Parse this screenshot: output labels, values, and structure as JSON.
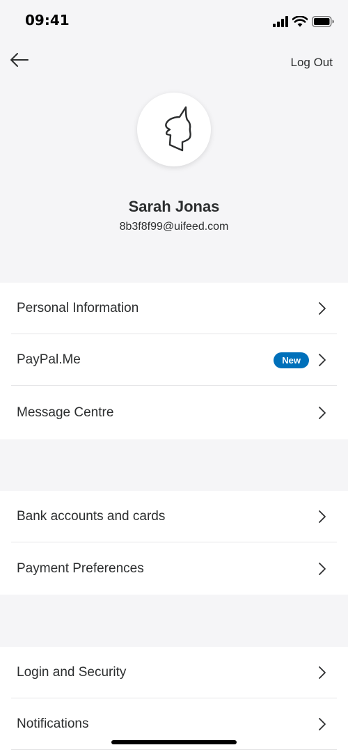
{
  "status_bar": {
    "time": "09:41"
  },
  "header": {
    "logout_label": "Log Out"
  },
  "profile": {
    "name": "Sarah Jonas",
    "email": "8b3f8f99@uifeed.com"
  },
  "menu_groups": [
    {
      "items": [
        {
          "label": "Personal Information"
        },
        {
          "label": "PayPal.Me",
          "badge": "New"
        },
        {
          "label": "Message Centre"
        }
      ]
    },
    {
      "items": [
        {
          "label": "Bank accounts and cards"
        },
        {
          "label": "Payment Preferences"
        }
      ]
    },
    {
      "items": [
        {
          "label": "Login and Security"
        },
        {
          "label": "Notifications"
        }
      ]
    }
  ],
  "colors": {
    "accent": "#0070ba",
    "background": "#f5f5f7",
    "text": "#2c2e2f"
  }
}
